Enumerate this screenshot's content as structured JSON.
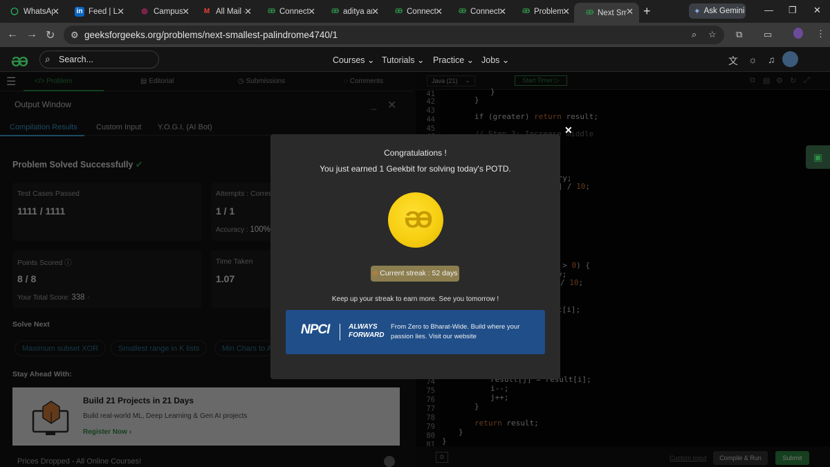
{
  "browser": {
    "tabs": [
      {
        "title": "WhatsAp",
        "icon": "whatsapp-icon",
        "color": "#25d366",
        "glyph": "◯"
      },
      {
        "title": "Feed | Lir",
        "icon": "linkedin-icon",
        "color": "#0a66c2",
        "glyph": "in"
      },
      {
        "title": "Campus",
        "icon": "instagram-icon",
        "color": "#d62976",
        "glyph": "◎"
      },
      {
        "title": "All Mail -",
        "icon": "gmail-icon",
        "color": "#ea4335",
        "glyph": "M"
      },
      {
        "title": "Connect",
        "icon": "gfg-icon",
        "color": "#2f8d46",
        "glyph": "ƏƏ"
      },
      {
        "title": "aditya ar",
        "icon": "gfg-icon",
        "color": "#2f8d46",
        "glyph": "ƏƏ"
      },
      {
        "title": "Connect",
        "icon": "gfg-icon",
        "color": "#2f8d46",
        "glyph": "ƏƏ"
      },
      {
        "title": "Connect",
        "icon": "gfg-icon",
        "color": "#2f8d46",
        "glyph": "ƏƏ"
      },
      {
        "title": "Problem",
        "icon": "gfg-icon",
        "color": "#2f8d46",
        "glyph": "ƏƏ"
      },
      {
        "title": "Next Sm",
        "icon": "gfg-icon",
        "color": "#2f8d46",
        "glyph": "ƏƏ",
        "active": true
      }
    ],
    "gemini_label": "Ask Gemini",
    "url": "geeksforgeeks.org/problems/next-smallest-palindrome4740/1"
  },
  "gfg_header": {
    "search_placeholder": "Search...",
    "menu": [
      "Courses",
      "Tutorials",
      "Practice",
      "Jobs"
    ]
  },
  "problem_tabs": {
    "problem": "Problem",
    "editorial": "Editorial",
    "submissions": "Submissions",
    "comments": "Comments"
  },
  "output_window": {
    "title": "Output Window",
    "tabs": [
      "Compilation Results",
      "Custom Input",
      "Y.O.G.I. (AI Bot)"
    ],
    "status": "Problem Solved Successfully",
    "cards": {
      "test_cases_label": "Test Cases Passed",
      "test_cases_value": "1111 / 1111",
      "attempts_label": "Attempts : Correc",
      "attempts_value": "1 / 1",
      "accuracy_label": "Accuracy :",
      "accuracy_value": "100%",
      "points_label": "Points Scored",
      "points_value": "8 / 8",
      "total_score_label": "Your Total Score:",
      "total_score_value": "338",
      "time_label": "Time Taken",
      "time_value": "1.07"
    },
    "solve_next_label": "Solve Next",
    "solve_next": [
      "Maximum subset XOR",
      "Smallest range in K lists",
      "Min Chars to A"
    ],
    "stay_ahead_label": "Stay Ahead With:",
    "promo_title": "Build 21 Projects in 21 Days",
    "promo_sub": "Build real-world ML, Deep Learning & Gen AI projects",
    "promo_cta": "Register Now ›",
    "prices_text": "Prices Dropped - All Online Courses!"
  },
  "editor": {
    "language": "Java (21)",
    "timer_label": "Start Timer",
    "line_numbers": [
      "41",
      "42",
      "43",
      "44",
      "45",
      "46",
      "74",
      "75",
      "76",
      "77",
      "78",
      "79",
      "80",
      "81"
    ],
    "custom_input": "Custom Input",
    "compile_run": "Compile & Run",
    "submit": "Submit"
  },
  "modal": {
    "title": "Congratulations !",
    "subtitle": "You just earned 1 Geekbit for solving today's POTD.",
    "streak": "Current streak : 52 days",
    "keep_up": "Keep up your streak to earn more. See you tomorrow !",
    "ad_brand": "NPCI",
    "ad_tagline_1": "ALWAYS",
    "ad_tagline_2": "FORWARD",
    "ad_text": "From Zero to Bharat-Wide. Build where your passion lies. Visit our website"
  },
  "colors": {
    "gfg_green": "#2f8d46",
    "accent_blue": "#3ba4d6",
    "coin_gold": "#f7cf12",
    "ad_blue": "#1f4e89"
  }
}
